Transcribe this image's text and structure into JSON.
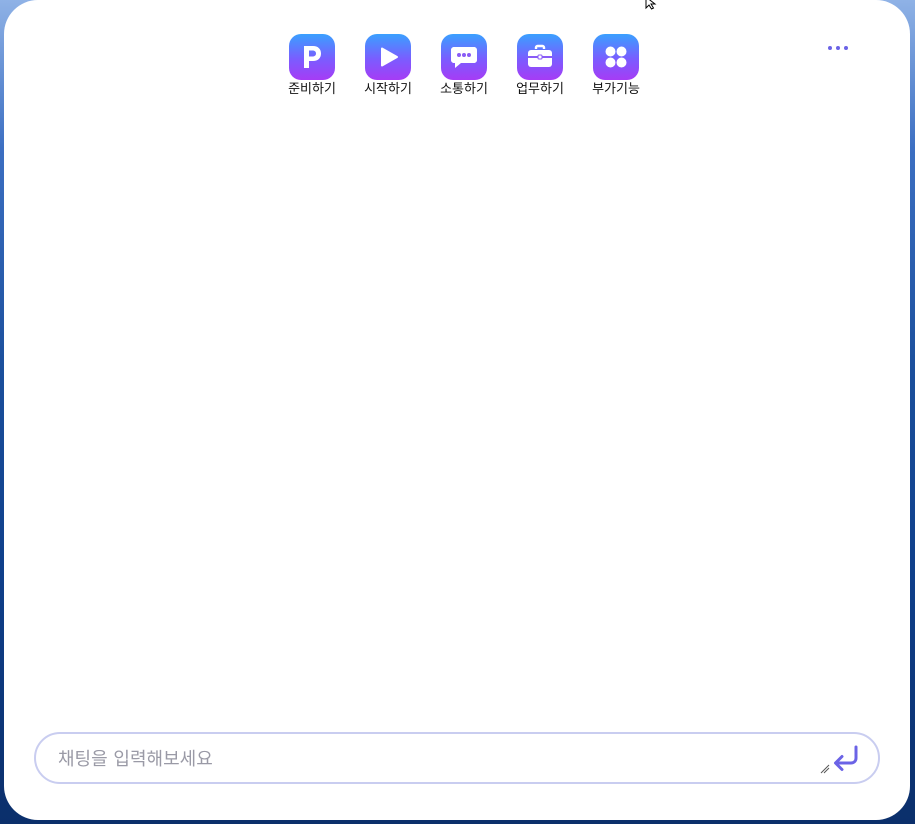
{
  "toolbar": {
    "items": [
      {
        "label": "준비하기",
        "icon": "p-letter-icon"
      },
      {
        "label": "시작하기",
        "icon": "play-icon"
      },
      {
        "label": "소통하기",
        "icon": "chat-bubble-icon"
      },
      {
        "label": "업무하기",
        "icon": "briefcase-icon"
      },
      {
        "label": "부가기능",
        "icon": "four-dots-icon"
      }
    ]
  },
  "more_menu": {
    "icon": "more-dots-icon"
  },
  "chat_input": {
    "placeholder": "채팅을 입력해보세요",
    "value": ""
  },
  "send": {
    "icon": "enter-arrow-icon"
  },
  "colors": {
    "accent": "#6b63e6",
    "icon_gradient_top": "#3aa0ff",
    "icon_gradient_bottom": "#a63cf5",
    "input_border": "#c9cdf0"
  }
}
